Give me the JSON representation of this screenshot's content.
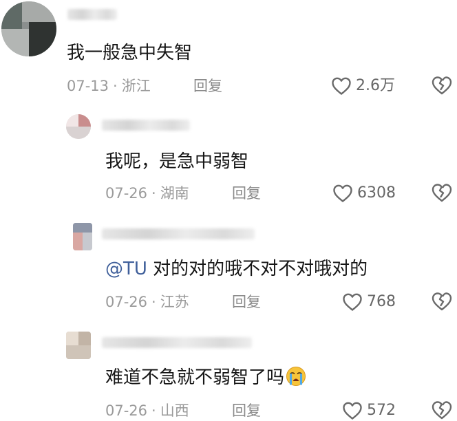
{
  "comments": [
    {
      "text": "我一般急中失智",
      "date": "07-13",
      "location": "浙江",
      "reply_label": "回复",
      "likes": "2.6万"
    },
    {
      "text": "我呢，是急中弱智",
      "date": "07-26",
      "location": "湖南",
      "reply_label": "回复",
      "likes": "6308"
    },
    {
      "mention": "@TU",
      "text": " 对的对的哦不对不对哦对的",
      "date": "07-26",
      "location": "江苏",
      "reply_label": "回复",
      "likes": "768"
    },
    {
      "text": "难道不急就不弱智了吗",
      "emoji": "loudly-crying-face",
      "date": "07-26",
      "location": "山西",
      "reply_label": "回复",
      "likes": "572"
    }
  ],
  "separator": "·",
  "icons": {
    "like": "heart-outline-icon",
    "dislike": "broken-heart-icon"
  },
  "colors": {
    "text": "#161616",
    "meta": "#9a9a9a",
    "mention": "#3f5f9a",
    "icon": "#6a6a6a"
  }
}
